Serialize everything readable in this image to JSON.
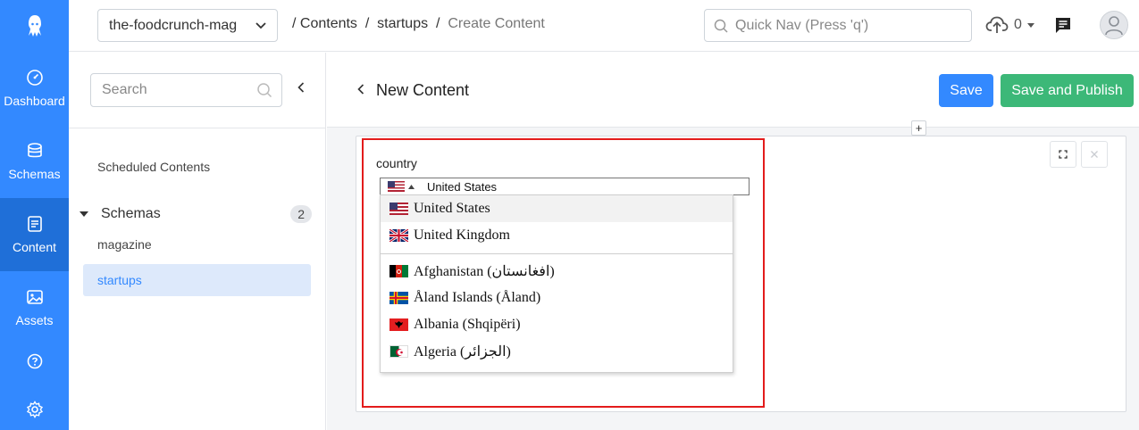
{
  "rail": {
    "items": [
      {
        "label": "Dashboard",
        "icon": "gauge-icon"
      },
      {
        "label": "Schemas",
        "icon": "database-icon"
      },
      {
        "label": "Content",
        "icon": "document-icon",
        "active": true
      },
      {
        "label": "Assets",
        "icon": "image-icon"
      }
    ],
    "help_icon": "help-icon",
    "settings_icon": "gear-icon"
  },
  "topbar": {
    "app_name": "the-foodcrunch-mag",
    "breadcrumb": [
      "Contents",
      "startups",
      "Create Content"
    ],
    "quick_nav_placeholder": "Quick Nav (Press 'q')",
    "upload_count": "0"
  },
  "sidebar": {
    "search_placeholder": "Search",
    "scheduled_label": "Scheduled Contents",
    "schemas_label": "Schemas",
    "schemas_count": "2",
    "schemas": [
      {
        "label": "magazine",
        "active": false
      },
      {
        "label": "startups",
        "active": true
      }
    ]
  },
  "main": {
    "title": "New Content",
    "save_label": "Save",
    "publish_label": "Save and Publish",
    "plus_label": "+"
  },
  "field": {
    "label": "country",
    "selected": "United States",
    "options_top": [
      "United States",
      "United Kingdom"
    ],
    "options": [
      "Afghanistan (افغانستان)",
      "Åland Islands (Åland)",
      "Albania (Shqipëri)",
      "Algeria (الجزائر)"
    ]
  },
  "colors": {
    "rail": "#3389ff",
    "rail_active": "#1f6fd8",
    "save": "#3389ff",
    "publish": "#3cb878",
    "highlight": "#e31c1c"
  }
}
